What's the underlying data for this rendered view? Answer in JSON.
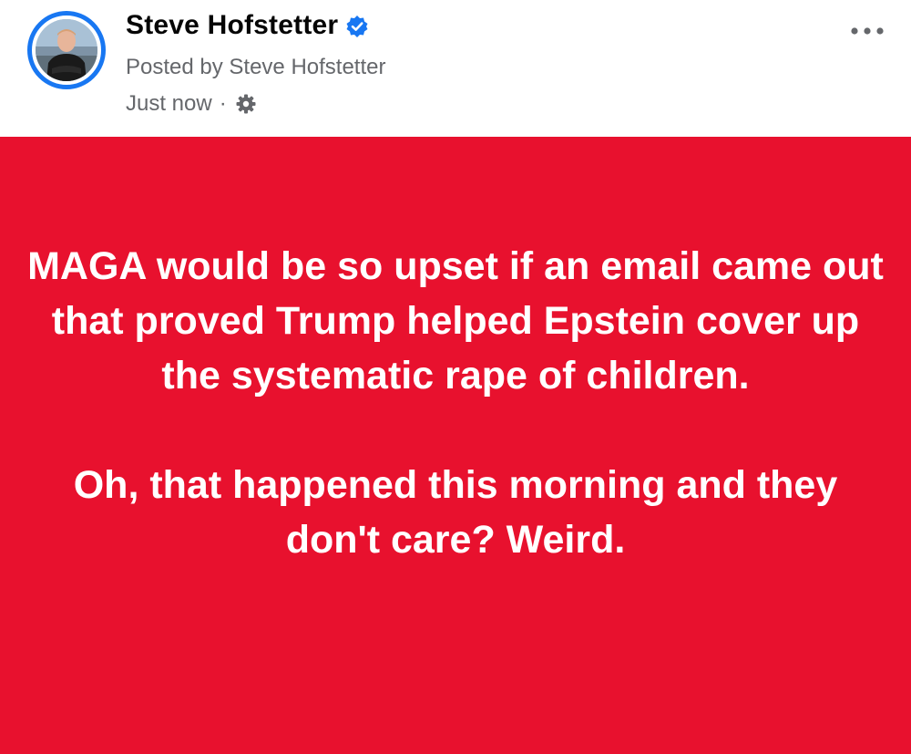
{
  "header": {
    "author_name": "Steve Hofstetter",
    "posted_by": "Posted by Steve Hofstetter",
    "timestamp": "Just now",
    "separator": "·",
    "avatar_icon": "profile-photo",
    "verified_icon": "verified-badge-icon",
    "privacy_icon": "gear-icon",
    "more_icon": "more-options-icon"
  },
  "post": {
    "background_color": "#e8112e",
    "text_color": "#ffffff",
    "paragraph_1": "MAGA would be so upset if an email came out that proved Trump helped Epstein cover up the systematic rape of children.",
    "paragraph_2": "Oh, that happened this morning and they don't care? Weird."
  },
  "colors": {
    "accent": "#1877f2",
    "secondary_text": "#65676b",
    "primary_text": "#050505"
  }
}
